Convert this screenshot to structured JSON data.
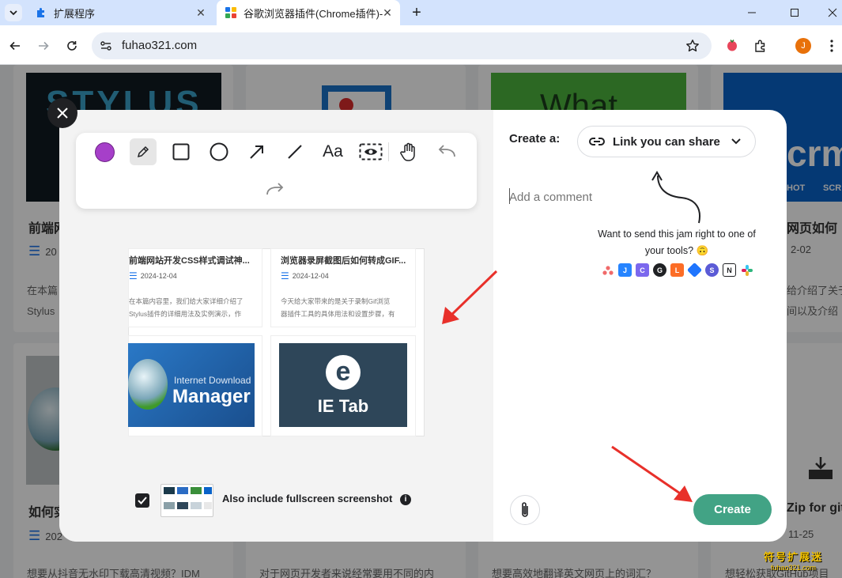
{
  "browser": {
    "tabs": [
      {
        "title": "扩展程序",
        "active": false
      },
      {
        "title": "谷歌浏览器插件(Chrome插件)-",
        "active": true
      }
    ],
    "new_tab_symbol": "+",
    "url": "fuhao321.com",
    "profile_initial": "J",
    "colors": {
      "tabstrip": "#d3e3fd",
      "omnibox": "#e9eef6",
      "profile": "#e8710a"
    }
  },
  "page": {
    "cards": [
      {
        "title": "前端网",
        "date": "20",
        "desc1": "在本篇",
        "desc2": "Stylus"
      },
      {
        "title": "如何实",
        "date": "202",
        "desc1": "想要从抖音无水印下载高清视频？IDM",
        "desc2": ""
      },
      {
        "title": "",
        "date": "",
        "desc1": "对于网页开发者来说经常要用不同的内",
        "desc2": ""
      },
      {
        "title": "",
        "date": "",
        "desc1": "想要高效地翻译英文网页上的词汇？",
        "desc2": ""
      },
      {
        "title": "网页如何",
        "date": "2-02",
        "desc1": "给介绍了关于",
        "desc2": "间以及介绍"
      },
      {
        "title": "Zip for git",
        "date": "11-25",
        "desc1": "想轻松获取GitHub项目",
        "desc2": ""
      }
    ],
    "thumb_texts": {
      "stylus": "STYLUS",
      "what": "What",
      "crm": "crm",
      "hot": "HOT",
      "scr": "SCR"
    }
  },
  "capture": {
    "tools": [
      "color-swatch",
      "pen",
      "rectangle",
      "circle",
      "arrow",
      "line",
      "text",
      "blur",
      "hand",
      "undo",
      "redo"
    ],
    "text_tool_label": "Aa",
    "color": "#a63fc9",
    "preview_cards": [
      {
        "title": "前端网站开发CSS样式调试神...",
        "date": "2024-12-04",
        "desc1": "在本篇内容里，我们给大家详细介绍了",
        "desc2": "Stylus插件的详细用法及实例演示，作"
      },
      {
        "title": "浏览器录屏截图后如何转成GIF...",
        "date": "2024-12-04",
        "desc1": "今天给大家带来的是关于录制Gif浏览",
        "desc2": "器插件工具的具体用法和设置步骤，有"
      }
    ],
    "preview_images": {
      "idm_line1": "Internet Download",
      "idm_line2": "Manager",
      "ietab": "IE Tab"
    },
    "create_label": "Create a:",
    "share_option": "Link you can share",
    "comment_placeholder": "Add a comment",
    "want_send": "Want to send this jam right to one of your tools?",
    "emoji": "🙃",
    "integrations": [
      "asana",
      "jira",
      "clickup",
      "github",
      "gitlab",
      "linear",
      "shortcut",
      "notion",
      "slack"
    ],
    "also_include": "Also include fullscreen screenshot",
    "include_checked": true,
    "create_button": "Create",
    "accent": "#42a385"
  },
  "watermark": {
    "line1": "符号扩展迷",
    "line2": "fuhao321.com"
  }
}
